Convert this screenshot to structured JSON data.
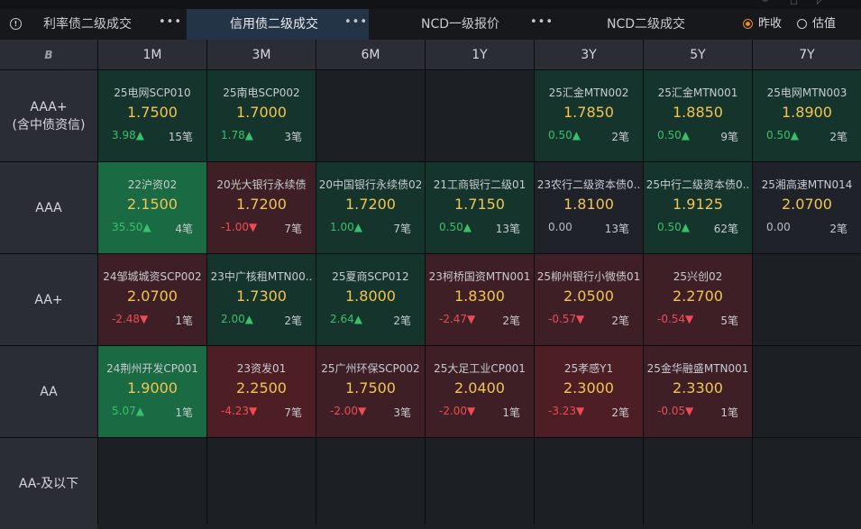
{
  "tabs": [
    {
      "label": "利率债二级成交",
      "active": false,
      "more": "•••"
    },
    {
      "label": "信用债二级成交",
      "active": true,
      "more": "•••"
    },
    {
      "label": "NCD一级报价",
      "active": false,
      "more": "•••"
    },
    {
      "label": "NCD二级成交",
      "active": false,
      "more": ""
    }
  ],
  "radios": [
    {
      "label": "昨收",
      "selected": true
    },
    {
      "label": "估值",
      "selected": false
    }
  ],
  "corner_icon": "B",
  "columns": [
    "1M",
    "3M",
    "6M",
    "1Y",
    "3Y",
    "5Y",
    "7Y"
  ],
  "rows": [
    {
      "label": "AAA+\n(含中债资信)",
      "cells": [
        {
          "name": "25电网SCP010",
          "price": "1.7500",
          "change": "3.98▲",
          "count": "15笔",
          "style": "green",
          "dir": "up"
        },
        {
          "name": "25南电SCP002",
          "price": "1.7000",
          "change": "1.78▲",
          "count": "3笔",
          "style": "green",
          "dir": "up"
        },
        null,
        null,
        {
          "name": "25汇金MTN002",
          "price": "1.7850",
          "change": "0.50▲",
          "count": "2笔",
          "style": "green",
          "dir": "up"
        },
        {
          "name": "25汇金MTN001",
          "price": "1.8850",
          "change": "0.50▲",
          "count": "9笔",
          "style": "green",
          "dir": "up"
        },
        {
          "name": "25电网MTN003",
          "price": "1.8900",
          "change": "0.50▲",
          "count": "2笔",
          "style": "green",
          "dir": "up"
        }
      ]
    },
    {
      "label": "AAA",
      "cells": [
        {
          "name": "22沪资02",
          "price": "2.1500",
          "change": "35.50▲",
          "count": "4笔",
          "style": "bright",
          "dir": "up"
        },
        {
          "name": "20光大银行永续债",
          "price": "1.7200",
          "change": "-1.00▼",
          "count": "7笔",
          "style": "red",
          "dir": "dn"
        },
        {
          "name": "20中国银行永续债02",
          "price": "1.7200",
          "change": "1.00▲",
          "count": "7笔",
          "style": "green",
          "dir": "up"
        },
        {
          "name": "21工商银行二级01",
          "price": "1.7150",
          "change": "0.50▲",
          "count": "13笔",
          "style": "green",
          "dir": "up"
        },
        {
          "name": "23农行二级资本债0..",
          "price": "1.8100",
          "change": "0.00",
          "count": "13笔",
          "style": "dark",
          "dir": "flat"
        },
        {
          "name": "25中行二级资本债0..",
          "price": "1.9125",
          "change": "0.50▲",
          "count": "62笔",
          "style": "green",
          "dir": "up"
        },
        {
          "name": "25湘高速MTN014",
          "price": "2.0700",
          "change": "0.00",
          "count": "2笔",
          "style": "dark",
          "dir": "flat"
        }
      ]
    },
    {
      "label": "AA+",
      "cells": [
        {
          "name": "24邹城城资SCP002",
          "price": "2.0700",
          "change": "-2.48▼",
          "count": "1笔",
          "style": "red",
          "dir": "dn"
        },
        {
          "name": "23中广核租MTN00..",
          "price": "1.7300",
          "change": "2.00▲",
          "count": "2笔",
          "style": "green",
          "dir": "up"
        },
        {
          "name": "25夏商SCP012",
          "price": "1.8000",
          "change": "2.64▲",
          "count": "2笔",
          "style": "green",
          "dir": "up"
        },
        {
          "name": "23柯桥国资MTN001",
          "price": "1.8300",
          "change": "-2.47▼",
          "count": "2笔",
          "style": "red",
          "dir": "dn"
        },
        {
          "name": "25柳州银行小微债01",
          "price": "2.0500",
          "change": "-0.57▼",
          "count": "2笔",
          "style": "red",
          "dir": "dn"
        },
        {
          "name": "25兴创02",
          "price": "2.2700",
          "change": "-0.54▼",
          "count": "5笔",
          "style": "red",
          "dir": "dn"
        },
        null
      ]
    },
    {
      "label": "AA",
      "cells": [
        {
          "name": "24荆州开发CP001",
          "price": "1.9000",
          "change": "5.07▲",
          "count": "1笔",
          "style": "bright",
          "dir": "up"
        },
        {
          "name": "23资发01",
          "price": "2.2500",
          "change": "-4.23▼",
          "count": "7笔",
          "style": "redd",
          "dir": "dn"
        },
        {
          "name": "25广州环保SCP002",
          "price": "1.7500",
          "change": "-2.00▼",
          "count": "3笔",
          "style": "red",
          "dir": "dn"
        },
        {
          "name": "25大足工业CP001",
          "price": "2.0400",
          "change": "-2.00▼",
          "count": "1笔",
          "style": "red",
          "dir": "dn"
        },
        {
          "name": "25孝感Y1",
          "price": "2.3000",
          "change": "-3.23▼",
          "count": "2笔",
          "style": "redd",
          "dir": "dn"
        },
        {
          "name": "25金华融盛MTN001",
          "price": "2.3300",
          "change": "-0.05▼",
          "count": "1笔",
          "style": "red",
          "dir": "dn"
        },
        null
      ]
    },
    {
      "label": "AA-及以下",
      "cells": [
        null,
        null,
        null,
        null,
        null,
        null,
        null
      ]
    }
  ]
}
